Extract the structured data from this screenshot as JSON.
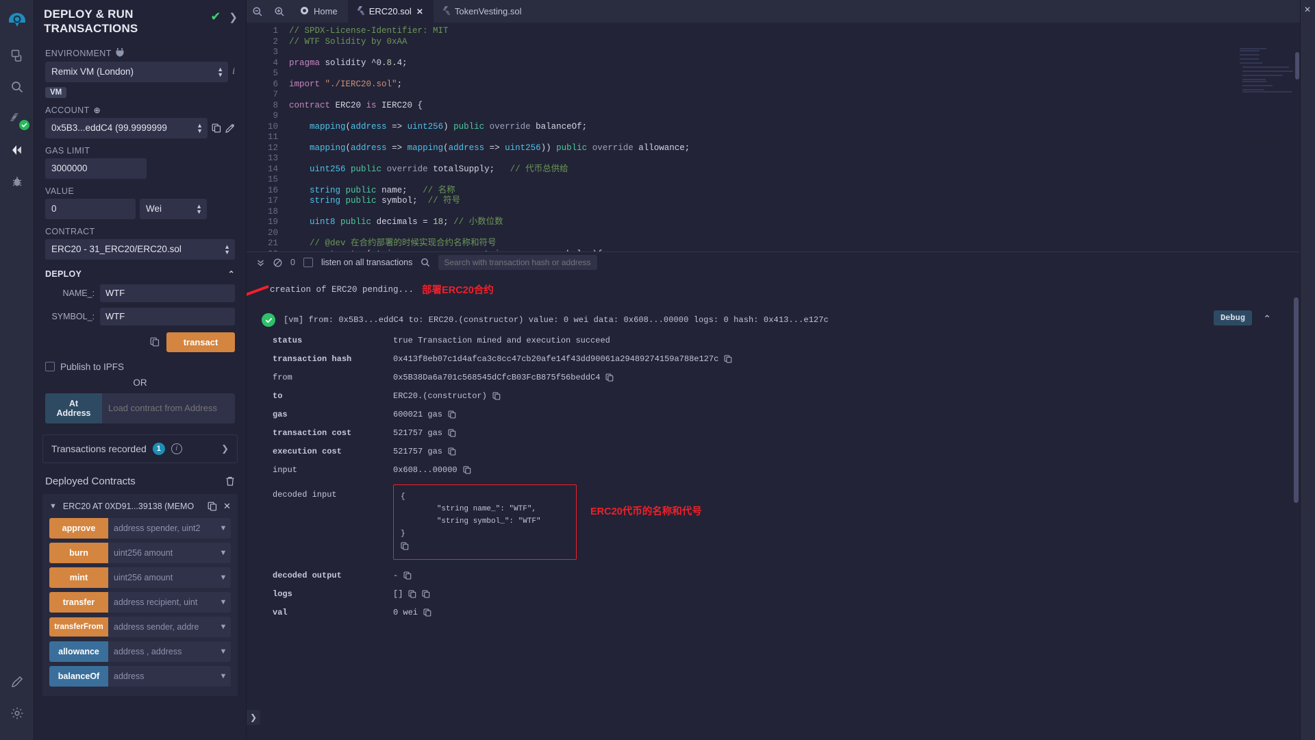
{
  "icon_rail": {
    "items": [
      {
        "name": "remix-logo-icon",
        "title": "Remix"
      },
      {
        "name": "file-explorer-icon",
        "title": "File explorer"
      },
      {
        "name": "search-icon",
        "title": "Search in files"
      },
      {
        "name": "solidity-compiler-icon",
        "title": "Solidity compiler"
      },
      {
        "name": "deploy-run-icon",
        "title": "Deploy & run transactions"
      },
      {
        "name": "debugger-icon",
        "title": "Debugger"
      }
    ],
    "bottom": [
      {
        "name": "plugin-manager-icon",
        "title": "Plugin manager"
      },
      {
        "name": "settings-gear-icon",
        "title": "Settings"
      }
    ]
  },
  "panel": {
    "title": "DEPLOY & RUN TRANSACTIONS",
    "environment_label": "ENVIRONMENT",
    "environment_value": "Remix VM (London)",
    "vm_badge": "VM",
    "account_label": "ACCOUNT",
    "account_value": "0x5B3...eddC4 (99.9999999",
    "gas_limit_label": "GAS LIMIT",
    "gas_limit_value": "3000000",
    "value_label": "VALUE",
    "value_amount": "0",
    "value_unit": "Wei",
    "contract_label": "CONTRACT",
    "contract_value": "ERC20 - 31_ERC20/ERC20.sol",
    "deploy_label": "DEPLOY",
    "deploy_params": [
      {
        "label": "NAME_:",
        "value": "WTF"
      },
      {
        "label": "SYMBOL_:",
        "value": "WTF"
      }
    ],
    "transact_label": "transact",
    "publish_ipfs_label": "Publish to IPFS",
    "or_label": "OR",
    "at_address_label": "At Address",
    "at_address_placeholder": "Load contract from Address",
    "transactions_recorded_label": "Transactions recorded",
    "transactions_recorded_count": "1",
    "deployed_contracts_label": "Deployed Contracts",
    "deployed_contract_name": "ERC20 AT 0XD91...39138 (MEMO",
    "functions": [
      {
        "name": "approve",
        "args": "address spender, uint2",
        "kind": "write"
      },
      {
        "name": "burn",
        "args": "uint256 amount",
        "kind": "write"
      },
      {
        "name": "mint",
        "args": "uint256 amount",
        "kind": "write"
      },
      {
        "name": "transfer",
        "args": "address recipient, uint",
        "kind": "write"
      },
      {
        "name": "transferFrom",
        "args": "address sender, addre",
        "kind": "write"
      },
      {
        "name": "allowance",
        "args": "address , address",
        "kind": "read"
      },
      {
        "name": "balanceOf",
        "args": "address",
        "kind": "read"
      }
    ]
  },
  "tabs": [
    {
      "label": "Home",
      "icon": "remix-home-icon",
      "active": false,
      "closable": false
    },
    {
      "label": "ERC20.sol",
      "icon": "solidity-file-icon",
      "active": true,
      "closable": true
    },
    {
      "label": "TokenVesting.sol",
      "icon": "solidity-file-icon",
      "active": false,
      "closable": false
    }
  ],
  "editor": {
    "first_line": 1,
    "lines": [
      "// SPDX-License-Identifier: MIT",
      "// WTF Solidity by 0xAA",
      "",
      "pragma solidity ^0.8.4;",
      "",
      "import \"./IERC20.sol\";",
      "",
      "contract ERC20 is IERC20 {",
      "",
      "    mapping(address => uint256) public override balanceOf;",
      "",
      "    mapping(address => mapping(address => uint256)) public override allowance;",
      "",
      "    uint256 public override totalSupply;   // 代币总供给",
      "",
      "    string public name;   // 名称",
      "    string public symbol;  // 符号",
      "",
      "    uint8 public decimals = 18; // 小数位数",
      "",
      "    // @dev 在合约部署的时候实现合约名称和符号",
      "    constructor(string memory name_, string memory symbol_ ){"
    ]
  },
  "terminal": {
    "count": "0",
    "listen_label": "listen on all transactions",
    "search_placeholder": "Search with transaction hash or address",
    "pending_text": "creation of ERC20 pending...",
    "pending_annotation": "部署ERC20合约",
    "summary": "[vm] from: 0x5B3...eddC4 to: ERC20.(constructor) value: 0 wei data: 0x608...00000 logs: 0 hash: 0x413...e127c",
    "debug_label": "Debug",
    "details": [
      {
        "key": "status",
        "value": "true Transaction mined and execution succeed",
        "copy": false,
        "bold": true
      },
      {
        "key": "transaction hash",
        "value": "0x413f8eb07c1d4afca3c8cc47cb20afe14f43dd90061a29489274159a788e127c",
        "copy": true,
        "bold": true
      },
      {
        "key": "from",
        "value": "0x5B38Da6a701c568545dCfcB03FcB875f56beddC4",
        "copy": true,
        "bold": false
      },
      {
        "key": "to",
        "value": "ERC20.(constructor)",
        "copy": true,
        "bold": true
      },
      {
        "key": "gas",
        "value": "600021 gas",
        "copy": true,
        "bold": true
      },
      {
        "key": "transaction cost",
        "value": "521757 gas",
        "copy": true,
        "bold": true
      },
      {
        "key": "execution cost",
        "value": "521757 gas",
        "copy": true,
        "bold": true
      },
      {
        "key": "input",
        "value": "0x608...00000",
        "copy": true,
        "bold": false
      }
    ],
    "decoded_input_key": "decoded input",
    "decoded_input_value": "{\n\t\"string name_\": \"WTF\",\n\t\"string symbol_\": \"WTF\"\n}",
    "decoded_input_annotation": "ERC20代币的名称和代号",
    "trailing_details": [
      {
        "key": "decoded output",
        "value": "-",
        "copy": true,
        "bold": true
      },
      {
        "key": "logs",
        "value": "[]",
        "copy": true,
        "bold": true,
        "double_copy": true
      },
      {
        "key": "val",
        "value": "0 wei",
        "copy": true,
        "bold": true
      }
    ]
  },
  "colors": {
    "accent_orange": "#d4853f",
    "accent_blue": "#3b6f9b",
    "success_green": "#2ec06a",
    "annotation_red": "#f1202a",
    "panel_bg": "#222336",
    "rail_bg": "#2a2c3f",
    "input_bg": "#30324a"
  }
}
